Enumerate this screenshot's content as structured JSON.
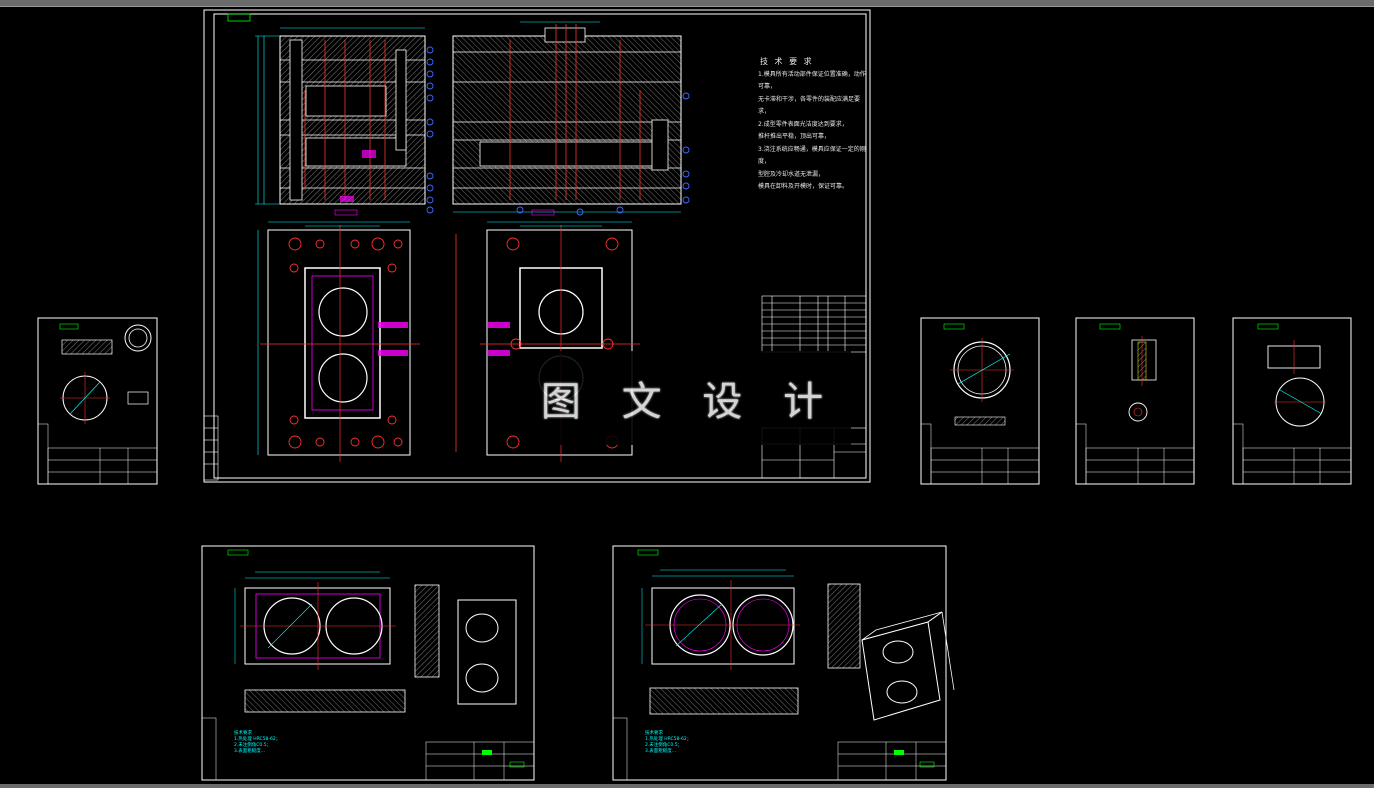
{
  "watermark": {
    "text": "图 文 设 计"
  },
  "tech_requirements": {
    "title": "技 术 要 求",
    "lines": [
      "1.模具所有活动部件保证位置准确，动作可靠，",
      "无卡滞和干涉，各零件的装配应满足要求，",
      "2.成型零件表面光洁度达到要求，",
      "推杆推出平稳，顶出可靠，",
      "3.浇注系统应畅通，模具应保证一定的刚度，",
      "型腔及冷却水道无泄漏，",
      "模具在卸料及开模时，保证可靠。"
    ]
  },
  "notes": {
    "title": "技术要求",
    "lines": [
      "1.热处理 HRC58-62；",
      "2.未注倒角C0.5；",
      "3.表面粗糙度..."
    ]
  },
  "colors": {
    "background": "#000000",
    "frame": "#ffffff",
    "outline": "#ffffff",
    "centerline": "#ff3030",
    "dimension": "#00ffff",
    "label_box": "#00ff00",
    "hatch": "#a0a0a0",
    "accent": "#ff00ff",
    "balloon": "#3a6bff",
    "yellow": "#ffff00"
  }
}
